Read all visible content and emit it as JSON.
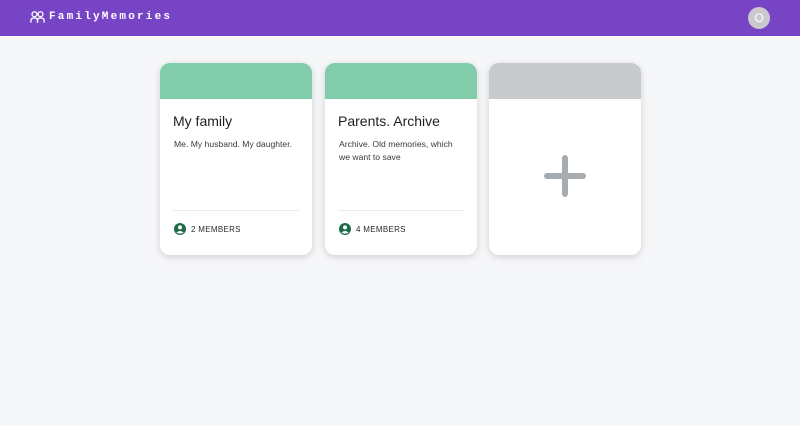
{
  "app": {
    "brand": "FamilyMemories",
    "user_initial": "O",
    "colors": {
      "header": "#7744c6",
      "accent": "#81ccab",
      "add_banner": "#c6cacd",
      "member_icon": "#1f6b48"
    }
  },
  "albums": [
    {
      "title": "My family",
      "description": "Me. My husband. My daughter.",
      "members": "2 MEMBERS"
    },
    {
      "title": "Parents. Archive",
      "description": "Archive. Old memories, which we want to save",
      "members": "4 MEMBERS"
    }
  ],
  "add_card": {
    "icon": "plus-icon"
  }
}
